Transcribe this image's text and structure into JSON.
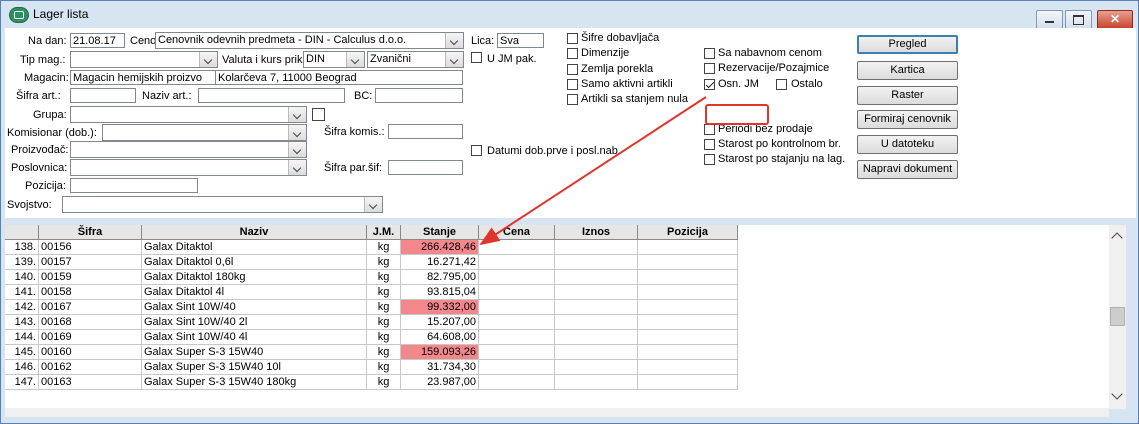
{
  "window": {
    "title": "Lager lista"
  },
  "form": {
    "na_dan_label": "Na dan:",
    "na_dan_value": "21.08.17",
    "cenovnik_label": "Cenovnik:",
    "cenovnik_value": "Cenovnik odevnih predmeta - DIN - Calculus d.o.o.",
    "lica_label": "Lica:",
    "lica_value": "Sva",
    "tip_mag_label": "Tip mag.:",
    "valuta_label": "Valuta i kurs prik:",
    "valuta_value": "DIN",
    "kurs_value": "Zvanični",
    "ujm_label": "U JM pak.",
    "magacin_label": "Magacin:",
    "magacin_value": "Magacin hemijskih proizvo",
    "magacin_address": "Kolarčeva 7, 11000 Beograd",
    "sifra_art_label": "Šifra art.:",
    "naziv_art_label": "Naziv art.:",
    "bc_label": "BC:",
    "grupa_label": "Grupa:",
    "komisionar_label": "Komisionar (dob.):",
    "sifra_komis_label": "Šifra komis.:",
    "proizvodjac_label": "Proizvođač:",
    "poslovnica_label": "Poslovnica:",
    "sifra_par_label": "Šifra par.šif:",
    "pozicija_label": "Pozicija:",
    "svojstvo_label": "Svojstvo:",
    "datumi_label": "Datumi dob.prve i posl.nab"
  },
  "options_col1": [
    "Šifre dobavljača",
    "Dimenzije",
    "Zemlja porekla",
    "Samo aktivni artikli",
    "Artikli sa stanjem nula"
  ],
  "options_col2": {
    "sa_nabavnom": "Sa nabavnom cenom",
    "rezervacije": "Rezervacije/Pozajmice",
    "osn_jm": "Osn. JM",
    "ostalo": "Ostalo",
    "periodi": "Periodi bez prodaje",
    "starost_kontrolnom": "Starost po kontrolnom br.",
    "starost_stajanju": "Starost po stajanju na lag."
  },
  "buttons": [
    "Pregled",
    "Kartica",
    "Raster",
    "Formiraj cenovnik",
    "U datoteku",
    "Napravi dokument"
  ],
  "grid": {
    "headers": [
      "Šifra",
      "Naziv",
      "J.M.",
      "Stanje",
      "Cena",
      "Iznos",
      "Pozicija"
    ],
    "rows": [
      {
        "no": "138.",
        "sifra": "00156",
        "naziv": "Galax Ditaktol",
        "jm": "kg",
        "stanje": "266.428,46",
        "hl": true
      },
      {
        "no": "139.",
        "sifra": "00157",
        "naziv": "Galax Ditaktol 0,6l",
        "jm": "kg",
        "stanje": "16.271,42",
        "hl": false
      },
      {
        "no": "140.",
        "sifra": "00159",
        "naziv": "Galax Ditaktol 180kg",
        "jm": "kg",
        "stanje": "82.795,00",
        "hl": false
      },
      {
        "no": "141.",
        "sifra": "00158",
        "naziv": "Galax Ditaktol 4l",
        "jm": "kg",
        "stanje": "93.815,04",
        "hl": false
      },
      {
        "no": "142.",
        "sifra": "00167",
        "naziv": "Galax Sint 10W/40",
        "jm": "kg",
        "stanje": "99.332,00",
        "hl": true
      },
      {
        "no": "143.",
        "sifra": "00168",
        "naziv": "Galax Sint 10W/40 2l",
        "jm": "kg",
        "stanje": "15.207,00",
        "hl": false
      },
      {
        "no": "144.",
        "sifra": "00169",
        "naziv": "Galax Sint 10W/40 4l",
        "jm": "kg",
        "stanje": "64.608,00",
        "hl": false
      },
      {
        "no": "145.",
        "sifra": "00160",
        "naziv": "Galax Super S-3 15W40",
        "jm": "kg",
        "stanje": "159.093,26",
        "hl": true
      },
      {
        "no": "146.",
        "sifra": "00162",
        "naziv": "Galax Super S-3 15W40 10l",
        "jm": "kg",
        "stanje": "31.734,30",
        "hl": false
      },
      {
        "no": "147.",
        "sifra": "00163",
        "naziv": "Galax Super S-3 15W40 180kg",
        "jm": "kg",
        "stanje": "23.987,00",
        "hl": false
      }
    ]
  },
  "colors": {
    "highlight_cell": "#f2878c",
    "annotation": "#e0352b"
  }
}
